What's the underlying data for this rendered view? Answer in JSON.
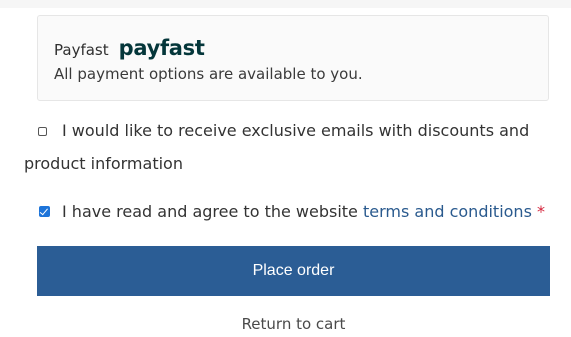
{
  "payment_method": {
    "label": "Payfast",
    "logo_text": "payfast",
    "description": "All payment options are available to you."
  },
  "marketing_opt_in": {
    "checked": false,
    "line1": "I would like to receive exclusive emails with discounts and",
    "line2": "product information"
  },
  "terms": {
    "checked": true,
    "text_before": "I have read and agree to the website ",
    "link_text": "terms and conditions",
    "required_mark": "*"
  },
  "actions": {
    "place_order_label": "Place order",
    "return_label": "Return to cart"
  },
  "colors": {
    "button_bg": "#2b5d95",
    "link": "#2a5a8e",
    "required": "#d4223a",
    "checkbox_checked": "#1d74d9",
    "logo": "#04363a"
  }
}
